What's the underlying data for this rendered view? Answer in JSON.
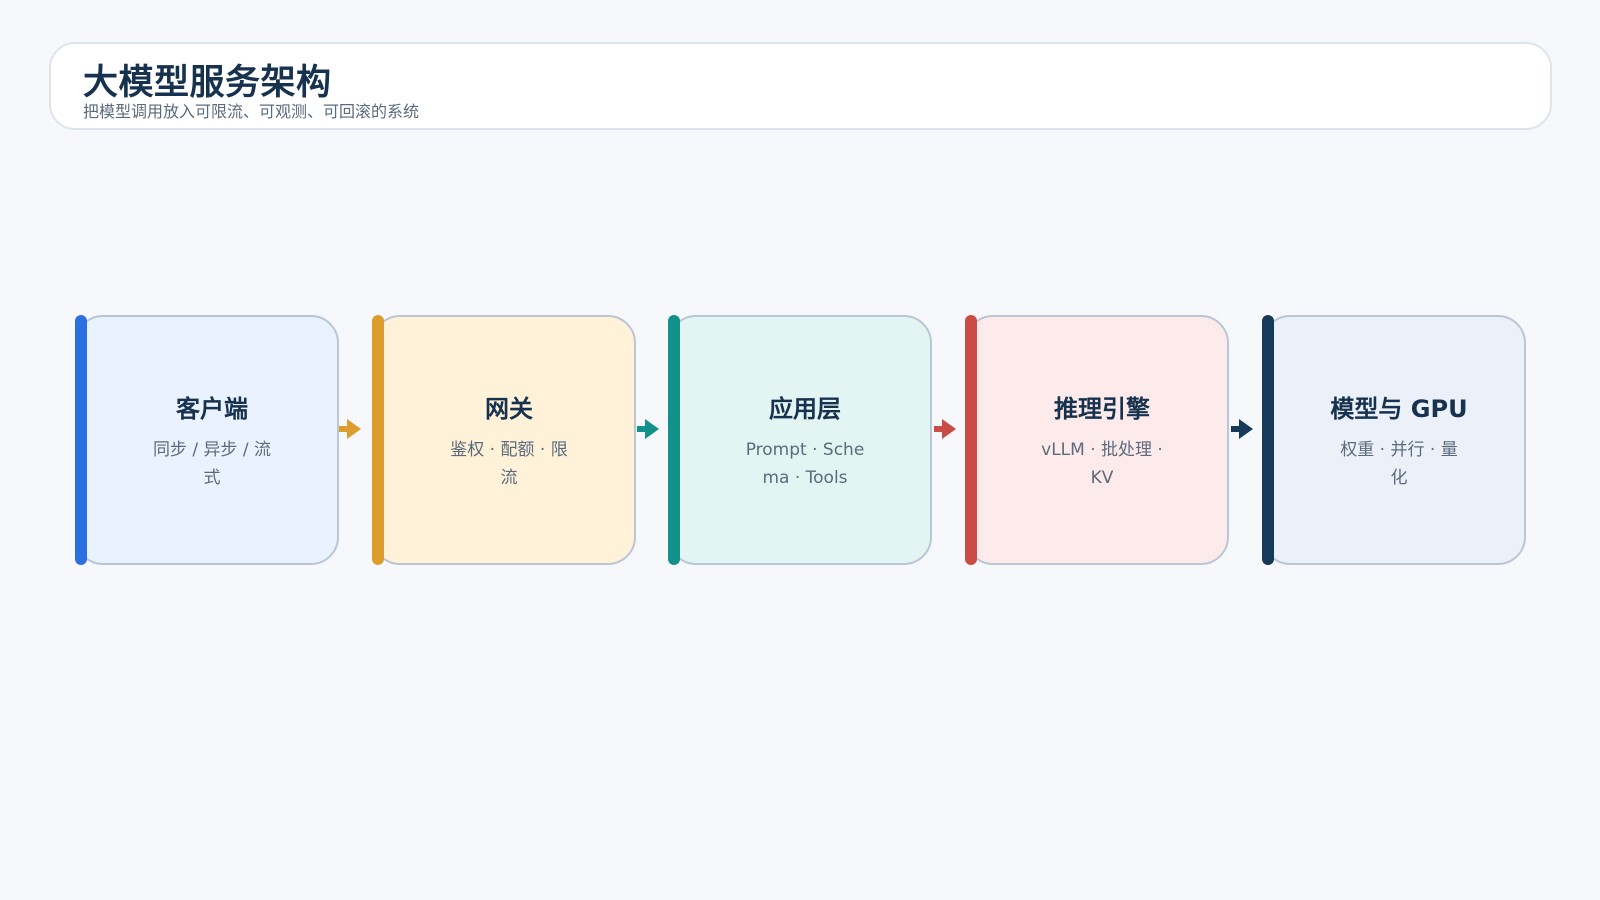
{
  "header": {
    "title": "大模型服务架构",
    "subtitle": "把模型调用放入可限流、可观测、可回滚的系统"
  },
  "stages": [
    {
      "title": "客户端",
      "desc": "同步 / 异步 / 流式",
      "accent": "#2c6fe0",
      "bg": "#eaf2ff"
    },
    {
      "title": "网关",
      "desc": "鉴权 · 配额 · 限流",
      "accent": "#dd9d2e",
      "bg": "#fff2d8"
    },
    {
      "title": "应用层",
      "desc": "Prompt · Schema · Tools",
      "accent": "#12918a",
      "bg": "#e3f5f3"
    },
    {
      "title": "推理引擎",
      "desc": "vLLM · 批处理 · KV",
      "accent": "#c94c47",
      "bg": "#fdeaea"
    },
    {
      "title": "模型与 GPU",
      "desc": "权重 · 并行 · 量化",
      "accent": "#173a58",
      "bg": "#ecf0f8"
    }
  ],
  "arrows": [
    {
      "from": "客户端",
      "to": "网关",
      "color": "#dd9d2e"
    },
    {
      "from": "网关",
      "to": "应用层",
      "color": "#12918a"
    },
    {
      "from": "应用层",
      "to": "推理引擎",
      "color": "#c94c47"
    },
    {
      "from": "推理引擎",
      "to": "模型与 GPU",
      "color": "#173a58"
    }
  ]
}
